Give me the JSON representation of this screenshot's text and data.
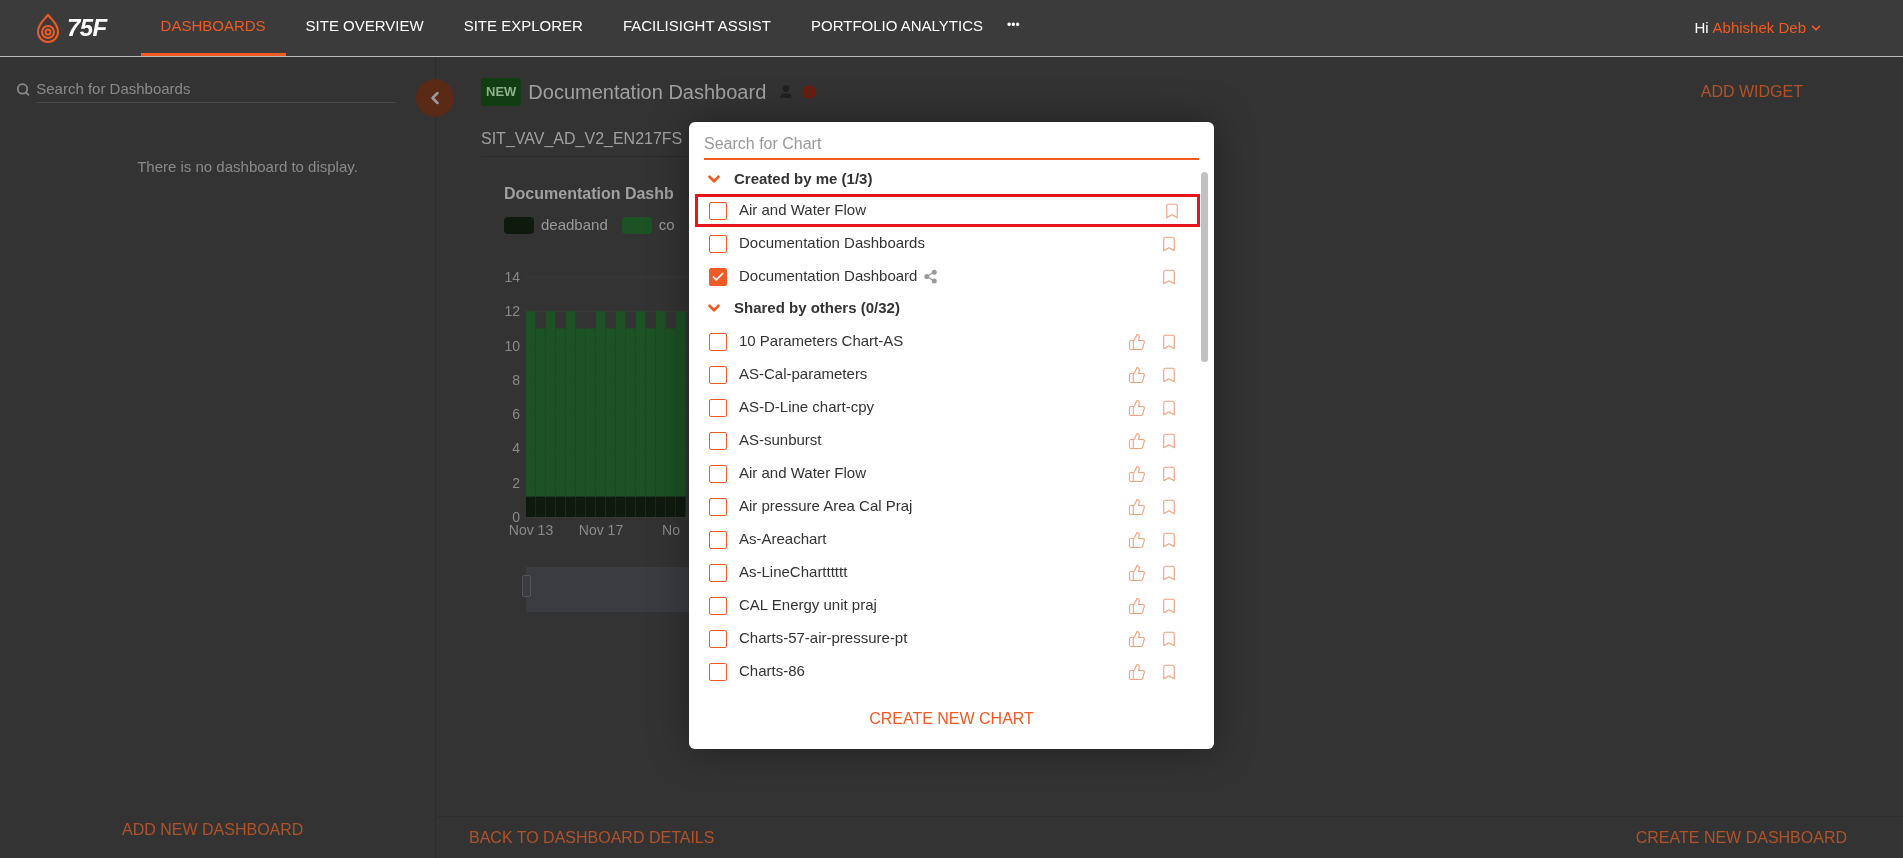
{
  "nav": {
    "logo": "75F",
    "items": [
      {
        "label": "DASHBOARDS",
        "selected": true
      },
      {
        "label": "SITE OVERVIEW",
        "selected": false
      },
      {
        "label": "SITE EXPLORER",
        "selected": false
      },
      {
        "label": "FACILISIGHT ASSIST",
        "selected": false
      },
      {
        "label": "PORTFOLIO ANALYTICS",
        "selected": false
      }
    ],
    "more": "•••",
    "greeting": "Hi",
    "user": "Abhishek Deb"
  },
  "sidebar": {
    "search_placeholder": "Search for Dashboards",
    "empty_message": "There is no dashboard to display.",
    "add_button": "ADD NEW DASHBOARD"
  },
  "dashboard": {
    "badge": "NEW",
    "title": "Documentation Dashboard",
    "add_widget": "ADD WIDGET",
    "site_select": "SIT_VAV_AD_V2_EN217FS",
    "widget": {
      "title": "Documentation Dashb",
      "chart_data": {
        "type": "bar",
        "stacked": true,
        "grid": true,
        "legend": true,
        "yticks": [
          0,
          2,
          4,
          6,
          8,
          10,
          12,
          14
        ],
        "ylim": [
          0,
          14
        ],
        "categories": [
          "Nov 13",
          null,
          null,
          null,
          null,
          null,
          null,
          "Nov 17",
          null,
          null,
          null,
          null,
          null,
          null,
          "No",
          null
        ],
        "series": [
          {
            "name": "deadband",
            "color": "#0f1a0f",
            "values": [
              1.2,
              1.2,
              1.2,
              1.2,
              1.2,
              1.2,
              1.2,
              1.2,
              1.2,
              1.2,
              1.2,
              1.2,
              1.2,
              1.2,
              1.2,
              1.2
            ]
          },
          {
            "name": "co",
            "color": "#1d5224",
            "values": [
              10.8,
              9.8,
              10.8,
              9.8,
              10.8,
              9.8,
              9.8,
              10.8,
              9.8,
              10.8,
              9.8,
              10.8,
              9.8,
              10.8,
              9.8,
              10.8
            ]
          }
        ]
      }
    },
    "back_button": "BACK TO DASHBOARD DETAILS",
    "create_button": "CREATE NEW DASHBOARD"
  },
  "modal": {
    "search_placeholder": "Search for Chart",
    "sections": [
      {
        "title": "Created by me (1/3)",
        "expanded": true,
        "items": [
          {
            "label": "Air and Water Flow",
            "checked": false,
            "highlighted": true,
            "shared": false,
            "likeable": false
          },
          {
            "label": "Documentation Dashboards",
            "checked": false,
            "highlighted": false,
            "shared": false,
            "likeable": false
          },
          {
            "label": "Documentation Dashboard",
            "checked": true,
            "highlighted": false,
            "shared": true,
            "likeable": false
          }
        ]
      },
      {
        "title": "Shared by others (0/32)",
        "expanded": true,
        "items": [
          {
            "label": "10 Parameters Chart-AS",
            "checked": false,
            "highlighted": false,
            "shared": false,
            "likeable": true
          },
          {
            "label": "AS-Cal-parameters",
            "checked": false,
            "highlighted": false,
            "shared": false,
            "likeable": true
          },
          {
            "label": "AS-D-Line chart-cpy",
            "checked": false,
            "highlighted": false,
            "shared": false,
            "likeable": true
          },
          {
            "label": "AS-sunburst",
            "checked": false,
            "highlighted": false,
            "shared": false,
            "likeable": true
          },
          {
            "label": "Air and Water Flow",
            "checked": false,
            "highlighted": false,
            "shared": false,
            "likeable": true
          },
          {
            "label": "Air pressure Area Cal Praj",
            "checked": false,
            "highlighted": false,
            "shared": false,
            "likeable": true
          },
          {
            "label": "As-Areachart",
            "checked": false,
            "highlighted": false,
            "shared": false,
            "likeable": true
          },
          {
            "label": "As-LineChartttttt",
            "checked": false,
            "highlighted": false,
            "shared": false,
            "likeable": true
          },
          {
            "label": "CAL Energy unit praj",
            "checked": false,
            "highlighted": false,
            "shared": false,
            "likeable": true
          },
          {
            "label": "Charts-57-air-pressure-pt",
            "checked": false,
            "highlighted": false,
            "shared": false,
            "likeable": true
          },
          {
            "label": "Charts-86",
            "checked": false,
            "highlighted": false,
            "shared": false,
            "likeable": true
          }
        ]
      }
    ],
    "create_button": "CREATE NEW CHART"
  }
}
